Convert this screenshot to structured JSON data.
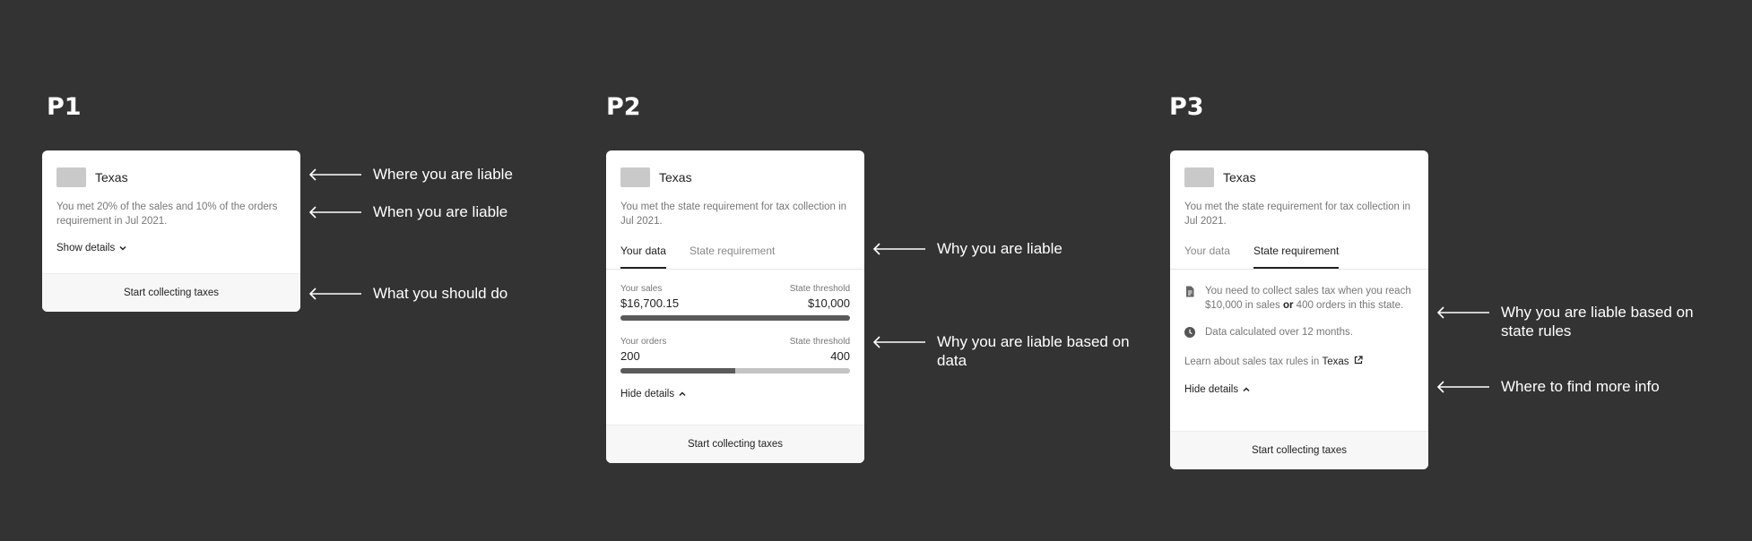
{
  "p1": {
    "title": "P1",
    "state": "Texas",
    "desc": "You met 20% of the sales and 10% of the orders requirement in Jul 2021.",
    "toggle": "Show details",
    "cta": "Start collecting taxes"
  },
  "p2": {
    "title": "P2",
    "state": "Texas",
    "desc": "You met the state requirement for tax collection in Jul 2021.",
    "tabs": [
      "Your data",
      "State requirement"
    ],
    "sales": {
      "label": "Your sales",
      "value": "$16,700.15",
      "threshold_label": "State threshold",
      "threshold": "$10,000",
      "progress": 1.0
    },
    "orders": {
      "label": "Your orders",
      "value": "200",
      "threshold_label": "State threshold",
      "threshold": "400",
      "progress": 0.5
    },
    "toggle": "Hide details",
    "cta": "Start collecting taxes"
  },
  "p3": {
    "title": "P3",
    "state": "Texas",
    "desc": "You met the state requirement for tax collection in Jul 2021.",
    "tabs": [
      "Your data",
      "State requirement"
    ],
    "req_pre": "You need to collect sales tax when you reach $10,000 in sales",
    "req_or": "or",
    "req_post": "400 orders in this state.",
    "calc": "Data calculated over 12 months.",
    "learn_pre": "Learn about sales tax rules in",
    "learn_link": "Texas",
    "toggle": "Hide details",
    "cta": "Start collecting taxes"
  },
  "annotations": {
    "where_liable": "Where you are liable",
    "when_liable": "When you are liable",
    "what_do": "What you should do",
    "why_liable": "Why you are liable",
    "why_data_1": "Why you are liable based on",
    "why_data_2": "data",
    "why_rules_1": "Why you are liable based on",
    "why_rules_2": "state rules",
    "more_info": "Where to find more info"
  },
  "colors": {
    "background": "#333333",
    "card": "#ffffff",
    "bar_fill": "#5a5a5a",
    "bar_track": "#c4c4c4"
  }
}
